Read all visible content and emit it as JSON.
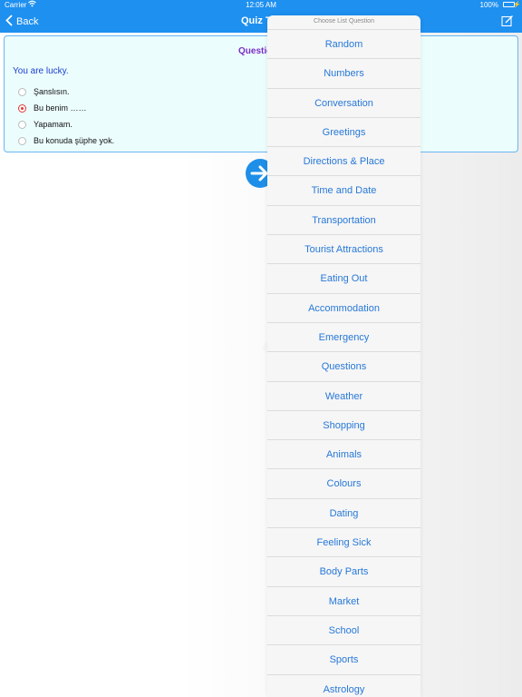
{
  "status": {
    "carrier": "Carrier",
    "time": "12:05 AM",
    "battery": "100%"
  },
  "nav": {
    "back_label": "Back",
    "title": "Quiz T"
  },
  "quiz": {
    "header": "Questic",
    "question": "You are lucky.",
    "options": [
      {
        "label": "Şanslısın.",
        "selected": false
      },
      {
        "label": "Bu benim ……",
        "selected": true
      },
      {
        "label": "Yapamam.",
        "selected": false
      },
      {
        "label": "Bu konuda şüphe yok.",
        "selected": false
      }
    ]
  },
  "popover": {
    "title": "Choose List Question",
    "items": [
      "Random",
      "Numbers",
      "Conversation",
      "Greetings",
      "Directions & Place",
      "Time and Date",
      "Transportation",
      "Tourist Attractions",
      "Eating Out",
      "Accommodation",
      "Emergency",
      "Questions",
      "Weather",
      "Shopping",
      "Animals",
      "Colours",
      "Dating",
      "Feeling Sick",
      "Body Parts",
      "Market",
      "School",
      "Sports",
      "Astrology"
    ]
  },
  "colors": {
    "accent": "#1e90f0",
    "list_text": "#2778d8",
    "question_header": "#7b2ec4",
    "question_text": "#1a3fd1",
    "radio_selected": "#e53535"
  },
  "icons": {
    "wifi": "wifi-icon",
    "back": "chevron-left-icon",
    "edit": "edit-icon",
    "next": "arrow-right-icon"
  }
}
